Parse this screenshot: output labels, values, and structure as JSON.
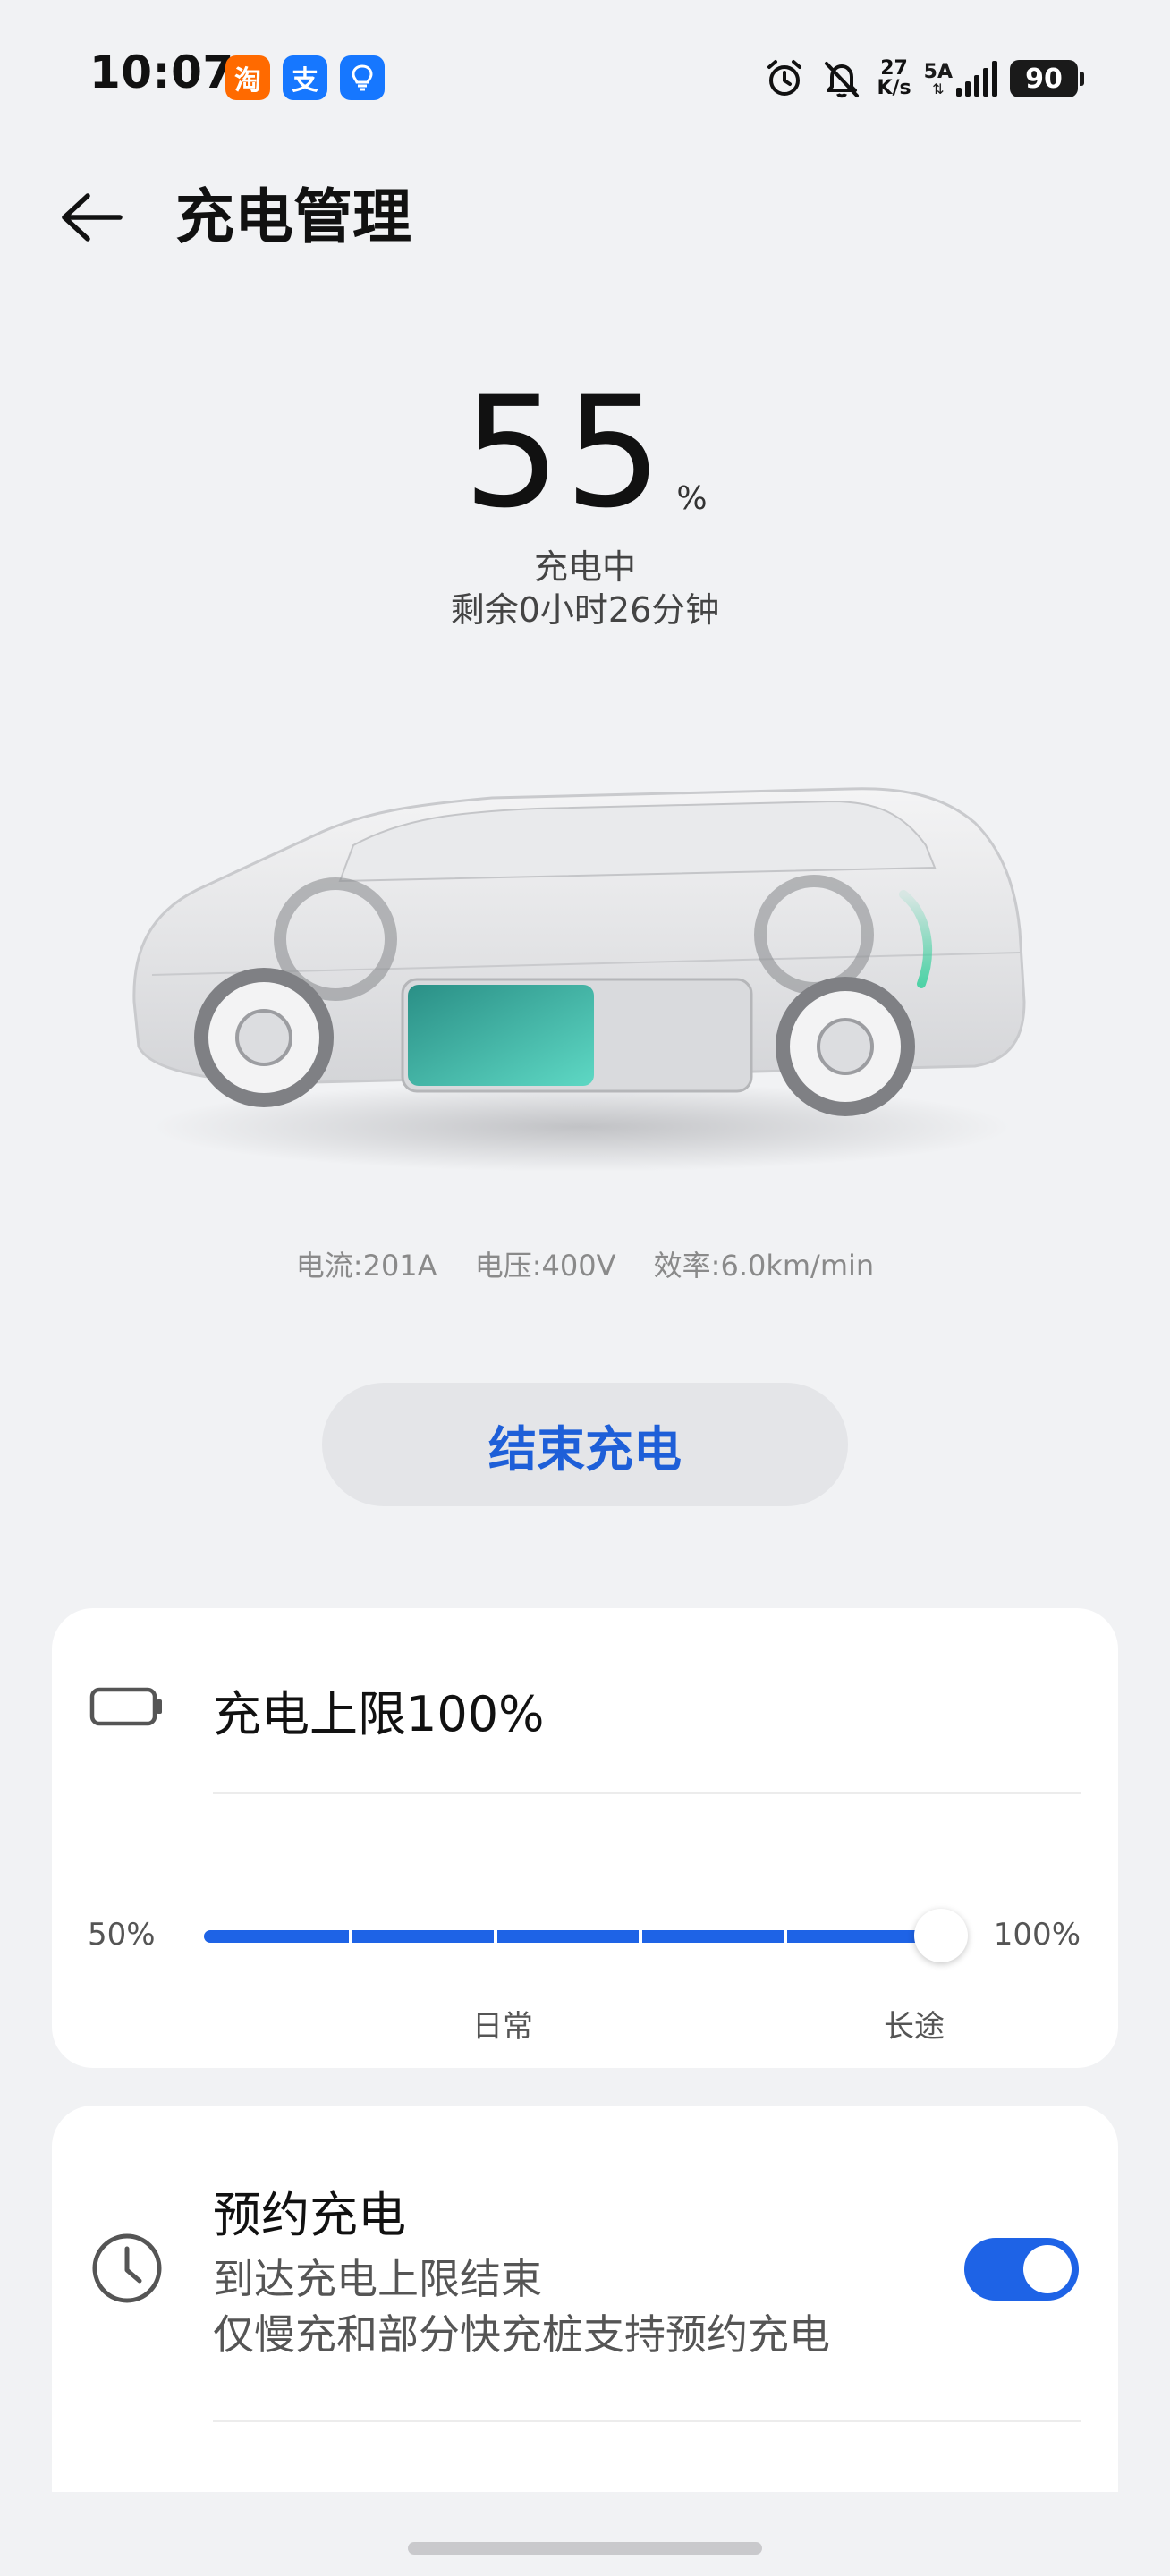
{
  "status_bar": {
    "time": "10:07",
    "apps": [
      {
        "name": "taobao",
        "glyph": "淘",
        "color": "#ff6a00"
      },
      {
        "name": "alipay",
        "glyph": "支",
        "color": "#1677ff"
      },
      {
        "name": "idea-bulb",
        "glyph": "",
        "color": "#1677ff"
      }
    ],
    "net_speed_value": "27",
    "net_speed_unit": "K/s",
    "signal_label": "5A",
    "battery_level": "90"
  },
  "header": {
    "title": "充电管理"
  },
  "charge": {
    "percent": "55",
    "unit": "%",
    "status": "充电中",
    "remaining": "剩余0小时26分钟",
    "level_fraction": 0.55
  },
  "metrics": {
    "current": "电流:201A",
    "voltage": "电压:400V",
    "efficiency": "效率:6.0km/min"
  },
  "stop_button": {
    "label": "结束充电"
  },
  "limit_card": {
    "title": "充电上限100%",
    "slider_min": "50%",
    "slider_max": "100%",
    "label_daily": "日常",
    "label_long_trip": "长途",
    "slider_value_fraction": 1.0
  },
  "schedule_card": {
    "title": "预约充电",
    "line1": "到达充电上限结束",
    "line2": "仅慢充和部分快充桩支持预约充电",
    "enabled": true
  },
  "colors": {
    "accent": "#1e63e6",
    "button_text": "#1e5fd8",
    "background": "#f1f2f4",
    "battery_glow": "#3fd1a0"
  }
}
